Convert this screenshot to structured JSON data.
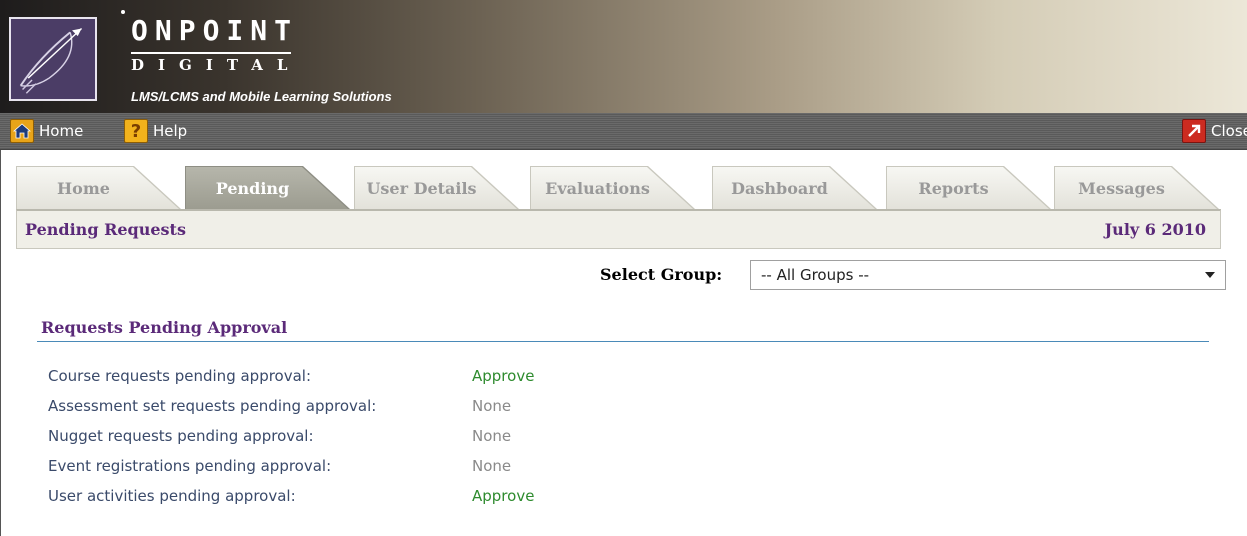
{
  "brand": {
    "name": "ONPOINT",
    "sub": "DIGITAL",
    "tagline": "LMS/LCMS and Mobile Learning Solutions"
  },
  "navbar": {
    "home_label": "Home",
    "help_label": "Help",
    "close_label": "Close",
    "home_icon": "house-icon",
    "help_icon": "question-icon",
    "close_icon": "exit-arrow-icon"
  },
  "tabs": [
    {
      "label": "Home",
      "active": false
    },
    {
      "label": "Pending",
      "active": true
    },
    {
      "label": "User Details",
      "active": false
    },
    {
      "label": "Evaluations",
      "active": false
    },
    {
      "label": "Dashboard",
      "active": false
    },
    {
      "label": "Reports",
      "active": false
    },
    {
      "label": "Messages",
      "active": false
    }
  ],
  "header": {
    "title": "Pending Requests",
    "date": "July 6 2010"
  },
  "group_filter": {
    "label": "Select Group:",
    "selected": "-- All Groups --"
  },
  "section": {
    "title": "Requests Pending Approval",
    "rows": [
      {
        "label": "Course requests pending approval:",
        "value": "Approve",
        "actionable": true
      },
      {
        "label": "Assessment set requests pending approval:",
        "value": "None",
        "actionable": false
      },
      {
        "label": "Nugget requests pending approval:",
        "value": "None",
        "actionable": false
      },
      {
        "label": "Event registrations pending approval:",
        "value": "None",
        "actionable": false
      },
      {
        "label": "User activities pending approval:",
        "value": "Approve",
        "actionable": true
      }
    ]
  },
  "colors": {
    "title_purple": "#5b2a79",
    "approve_green": "#2e8b2e",
    "none_gray": "#8a8a8a",
    "rule_blue": "#4a8ab8"
  }
}
